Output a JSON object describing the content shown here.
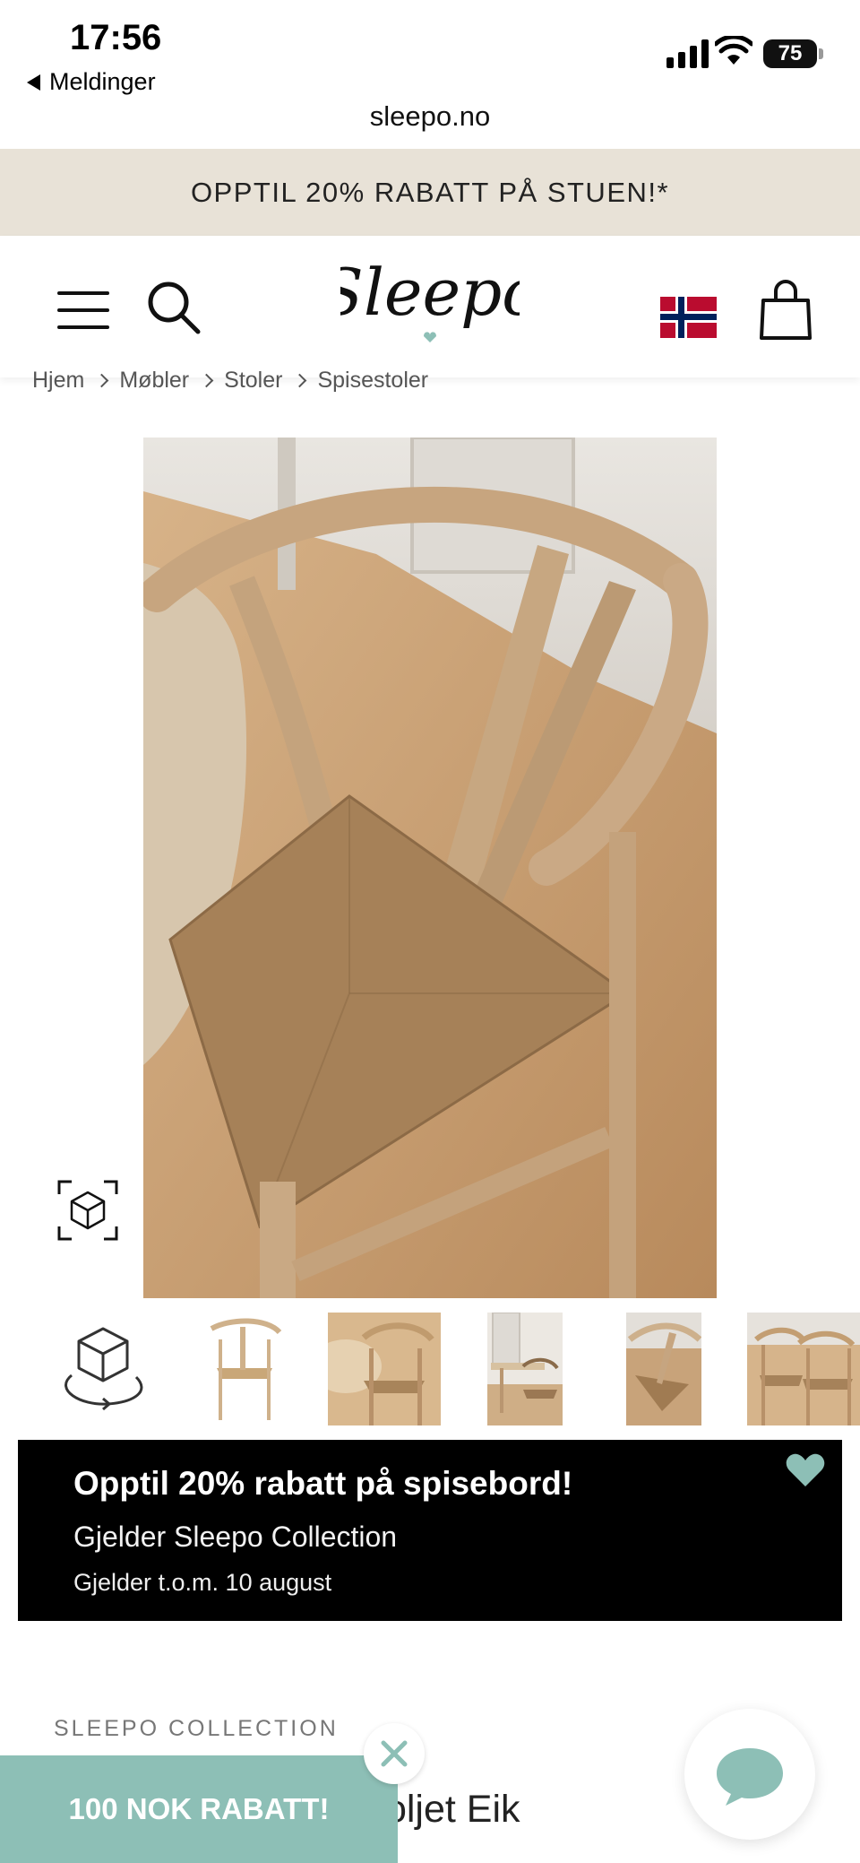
{
  "status_bar": {
    "time": "17:56",
    "back_label": "Meldinger",
    "battery": "75"
  },
  "browser": {
    "url": "sleepo.no"
  },
  "promo_banner": {
    "text": "OPPTIL 20% RABATT PÅ STUEN!*"
  },
  "header": {
    "logo_text": "Sleepo",
    "flag": "norway-flag-icon",
    "accent_color": "#8dbfb6"
  },
  "breadcrumb": [
    "Hjem",
    "Møbler",
    "Stoler",
    "Spisestoler"
  ],
  "sale_box": {
    "title": "Opptil 20% rabatt på spisebord!",
    "subtitle": "Gjelder Sleepo Collection",
    "validity": "Gjelder t.o.m. 10 august"
  },
  "product": {
    "brand": "SLEEPO COLLECTION",
    "title_visible": "toljet Eik"
  },
  "discount_popup": {
    "label": "100 NOK RABATT!"
  },
  "colors": {
    "promo_bg": "#e8e2d7",
    "sale_bg": "#000000",
    "teal": "#8dbfb6"
  }
}
